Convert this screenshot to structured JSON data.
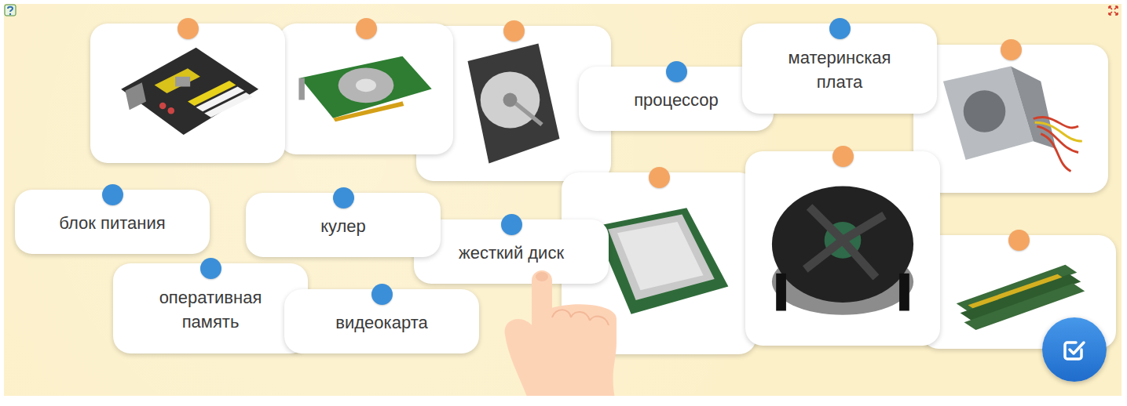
{
  "images": [
    {
      "color": "#f5a562"
    },
    {
      "color": "#f5a562"
    },
    {
      "color": "#f5a562"
    },
    {
      "color": "#f5a562"
    },
    {
      "color": "#f5a562"
    },
    {
      "color": "#f5a562"
    },
    {
      "color": "#f5a562"
    }
  ],
  "labels": [
    {
      "text": "процессор",
      "color": "#3b8fd9"
    },
    {
      "text": "материнская плата",
      "color": "#3b8fd9"
    },
    {
      "text": "жесткий диск",
      "color": "#3b8fd9"
    },
    {
      "text": "блок питания",
      "color": "#3b8fd9"
    },
    {
      "text": "кулер",
      "color": "#3b8fd9"
    },
    {
      "text": "оперативная память",
      "color": "#3b8fd9"
    },
    {
      "text": "видеокарта",
      "color": "#3b8fd9"
    }
  ]
}
